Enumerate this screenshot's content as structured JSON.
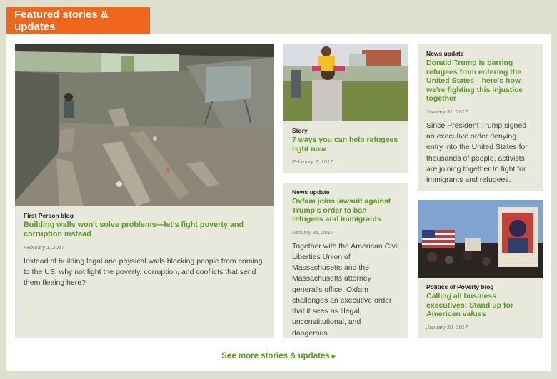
{
  "header": {
    "title": "Featured stories & updates"
  },
  "stories": [
    {
      "tag": "First Person blog",
      "headline": "Building walls won't solve problems—let's fight poverty and corruption instead",
      "date": "February 1, 2017",
      "summary": "Instead of building legal and physical walls blocking people from coming to the US, why not fight the poverty, corruption, and conflicts that send them fleeing here?"
    },
    {
      "tag": "Story",
      "headline": "7 ways you can help refugees right now",
      "date": "February 2, 2017"
    },
    {
      "tag": "News update",
      "headline": "Oxfam joins lawsuit against Trump's order to ban refugees and immigrants",
      "date": "January 31, 2017",
      "summary": "Together with the American Civil Liberties Union of Massachusetts and the Massachusetts attorney general's office, Oxfam challenges an executive order that it sees as illegal, unconstitutional, and dangerous."
    },
    {
      "tag": "News update",
      "headline": "Donald Trump is barring refugees from entering the United States—here's how we're fighting this injustice together",
      "date": "January 31, 2017",
      "summary": "Since President Trump signed an executive order denying entry into the United States for thousands of people, activists are joining together to fight for immigrants and refugees."
    },
    {
      "tag": "Politics of Poverty blog",
      "headline": "Calling all business executives: Stand up for American values",
      "date": "January 30, 2017"
    }
  ],
  "footer": {
    "see_more": "See more stories & updates"
  },
  "colors": {
    "accent_orange": "#f1661d",
    "link_green": "#5a9a1e",
    "card_bg": "#e8e8dd"
  }
}
